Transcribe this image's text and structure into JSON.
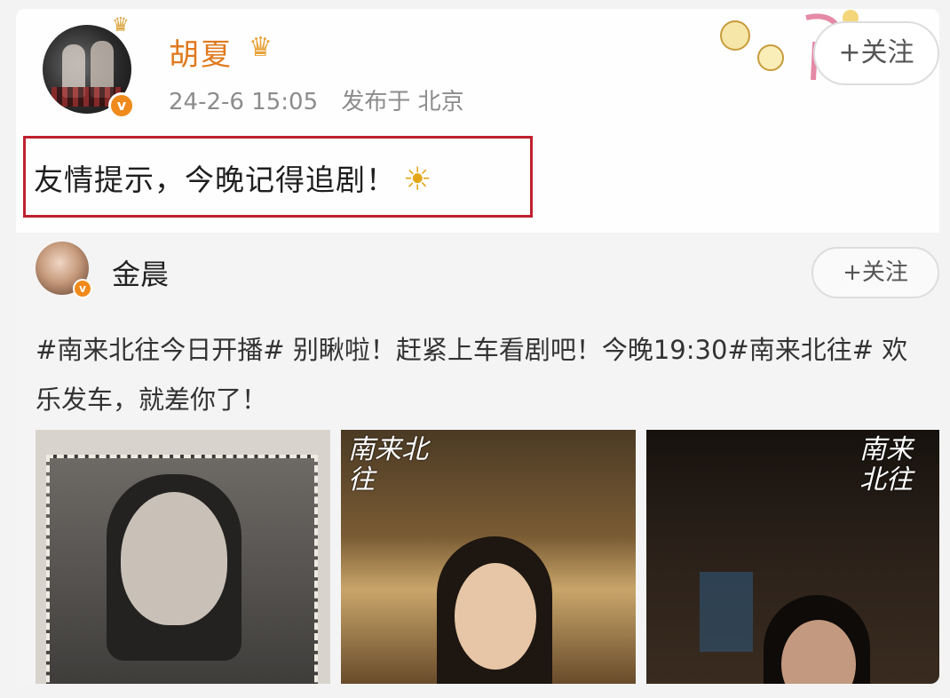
{
  "post": {
    "username": "胡夏",
    "date": "24-2-6 15:05",
    "location": "发布于 北京",
    "follow_label": "+关注",
    "text": "友情提示，今晚记得追剧！",
    "emoji": "☀"
  },
  "repost": {
    "username": "金晨",
    "follow_label": "+关注",
    "text": "#南来北往今日开播# 别瞅啦！赶紧上车看剧吧！今晚19:30#南来北往# 欢乐发车，就差你了！",
    "images": [
      {
        "name": "photo-1"
      },
      {
        "name": "photo-2",
        "overlay_text": "南来北往"
      },
      {
        "name": "photo-3",
        "overlay_text": "南来北往"
      }
    ]
  },
  "colors": {
    "username": "#e07a1e",
    "highlight_border": "#c0202e",
    "verified_badge": "#f08a1c"
  }
}
